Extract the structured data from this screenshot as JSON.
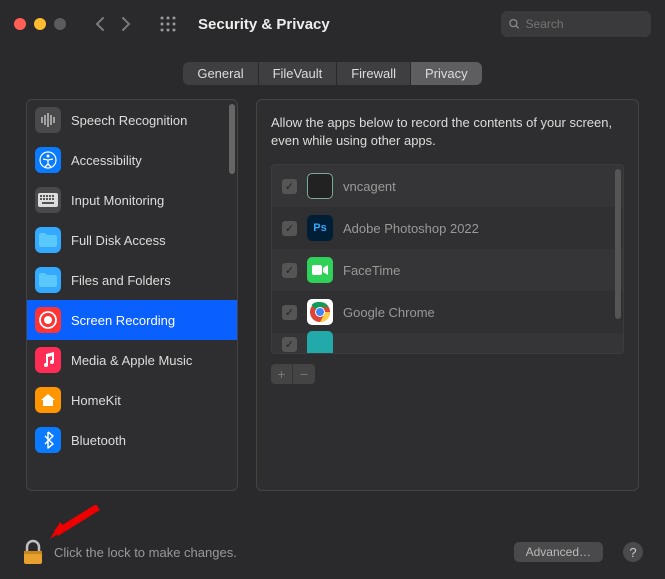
{
  "window": {
    "title": "Security & Privacy"
  },
  "search": {
    "placeholder": "Search"
  },
  "tabs": {
    "t0": "General",
    "t1": "FileVault",
    "t2": "Firewall",
    "t3": "Privacy"
  },
  "sidebar": {
    "items": [
      {
        "label": "Speech Recognition",
        "icon": "speech",
        "bg": "#4a4a4c"
      },
      {
        "label": "Accessibility",
        "icon": "accessibility",
        "bg": "#0a7bff"
      },
      {
        "label": "Input Monitoring",
        "icon": "keyboard",
        "bg": "#4a4a4c"
      },
      {
        "label": "Full Disk Access",
        "icon": "folder",
        "bg": "#33aaff"
      },
      {
        "label": "Files and Folders",
        "icon": "folder",
        "bg": "#33aaff"
      },
      {
        "label": "Screen Recording",
        "icon": "record",
        "bg": "#ff3333",
        "selected": true
      },
      {
        "label": "Media & Apple Music",
        "icon": "music",
        "bg": "#ff2d55"
      },
      {
        "label": "HomeKit",
        "icon": "home",
        "bg": "#ff9500"
      },
      {
        "label": "Bluetooth",
        "icon": "bluetooth",
        "bg": "#0a7bff"
      }
    ]
  },
  "detail": {
    "description": "Allow the apps below to record the contents of your screen, even while using other apps.",
    "apps": [
      {
        "name": "vncagent",
        "checked": true,
        "color": "#222",
        "inner": "#7a9"
      },
      {
        "name": "Adobe Photoshop 2022",
        "checked": true,
        "color": "#001e36",
        "inner": "#31a8ff",
        "letters": "Ps"
      },
      {
        "name": "FaceTime",
        "checked": true,
        "color": "#30d158",
        "inner": "#fff"
      },
      {
        "name": "Google Chrome",
        "checked": true,
        "color": "#fff",
        "inner": ""
      }
    ]
  },
  "footer": {
    "lock_text": "Click the lock to make changes.",
    "advanced": "Advanced…",
    "help": "?"
  }
}
